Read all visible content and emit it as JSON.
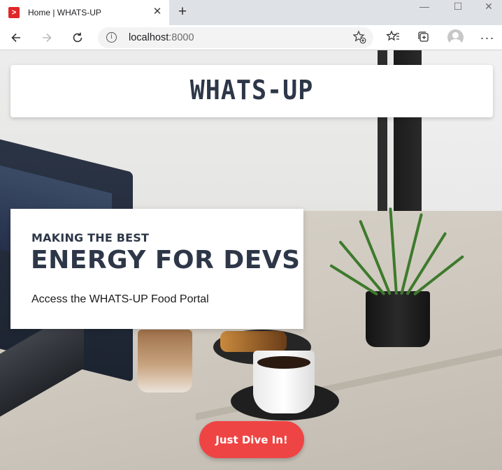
{
  "browser": {
    "tab_title": "Home | WHATS-UP",
    "favicon_glyph": ">",
    "tab_close": "✕",
    "new_tab": "+",
    "url_host": "localhost",
    "url_port": ":8000",
    "info_glyph": "i",
    "window_controls": [
      "—",
      "☐",
      "✕"
    ]
  },
  "page": {
    "brand": "WHATS-UP",
    "hero": {
      "subtitle": "MAKING THE BEST",
      "title": "ENERGY FOR DEVS",
      "description": "Access the WHATS-UP Food Portal"
    },
    "cta_label": "Just Dive In!"
  },
  "colors": {
    "accent": "#ef4444",
    "brand_text": "#2d3748",
    "favicon": "#e0262a"
  },
  "icons": [
    "back-icon",
    "forward-icon",
    "refresh-icon",
    "info-icon",
    "favorite-add-icon",
    "favorites-icon",
    "collections-icon",
    "profile-avatar-icon",
    "more-menu-icon"
  ]
}
